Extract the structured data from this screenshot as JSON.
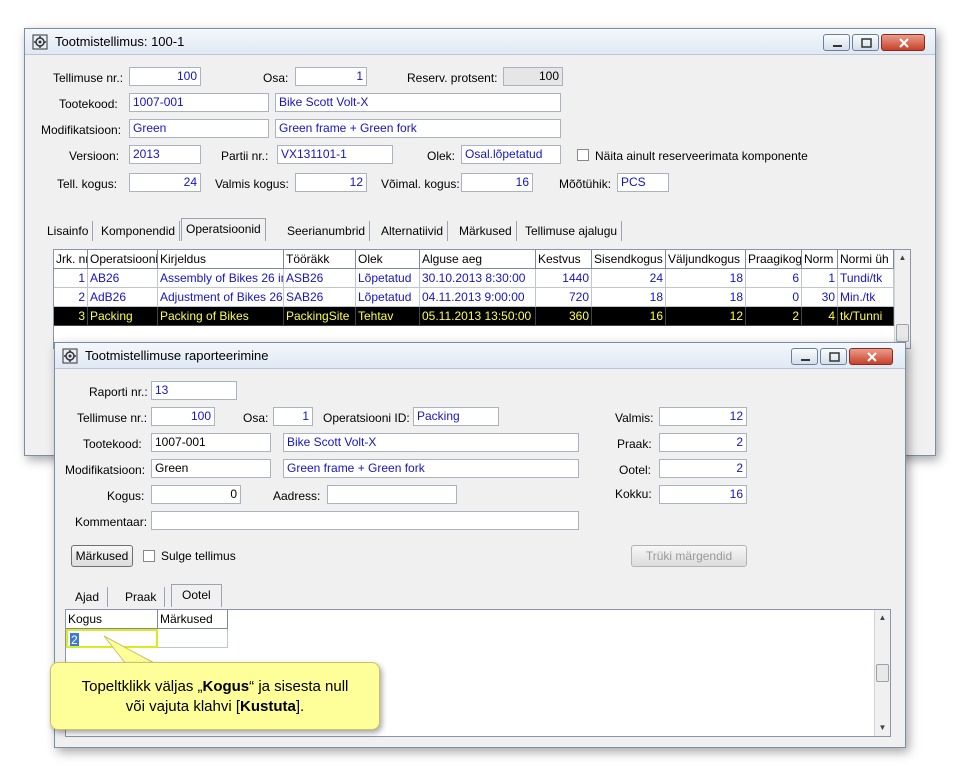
{
  "main_window": {
    "title": "Tootmistellimus: 100-1",
    "fields": {
      "tellimuse_nr": {
        "label": "Tellimuse nr.:",
        "value": "100"
      },
      "osa": {
        "label": "Osa:",
        "value": "1"
      },
      "reserv": {
        "label": "Reserv. protsent:",
        "value": "100"
      },
      "tootekood": {
        "label": "Tootekood:",
        "value": "1007-001",
        "desc": "Bike Scott Volt-X"
      },
      "modifikatsioon": {
        "label": "Modifikatsioon:",
        "value": "Green",
        "desc": "Green frame + Green fork"
      },
      "versioon": {
        "label": "Versioon:",
        "value": "2013"
      },
      "partii": {
        "label": "Partii nr.:",
        "value": "VX131101-1"
      },
      "olek": {
        "label": "Olek:",
        "value": "Osal.lõpetatud"
      },
      "naita_checkbox": "Näita ainult reserveerimata komponente",
      "tell_kogus": {
        "label": "Tell. kogus:",
        "value": "24"
      },
      "valmis_kogus": {
        "label": "Valmis kogus:",
        "value": "12"
      },
      "voimal_kogus": {
        "label": "Võimal. kogus:",
        "value": "16"
      },
      "mootuhik": {
        "label": "Mõõtühik:",
        "value": "PCS"
      }
    },
    "tabs": [
      "Lisainfo",
      "Komponendid",
      "Operatsioonid",
      "Seerianumbrid",
      "Alternatiivid",
      "Märkused",
      "Tellimuse ajalugu"
    ],
    "grid": {
      "headers": [
        "Jrk. nr",
        "Operatsiooni",
        "Kirjeldus",
        "Tööräkk",
        "Olek",
        "Alguse aeg",
        "Kestvus",
        "Sisendkogus",
        "Väljundkogus",
        "Praagikog",
        "Norm",
        "Normi üh"
      ],
      "rows": [
        [
          "1",
          "AB26",
          "Assembly of Bikes 26 in",
          "ASB26",
          "Lõpetatud",
          "30.10.2013 8:30:00",
          "1440",
          "24",
          "18",
          "6",
          "1",
          "Tundi/tk"
        ],
        [
          "2",
          "AdB26",
          "Adjustment of Bikes 26",
          "SAB26",
          "Lõpetatud",
          "04.11.2013 9:00:00",
          "720",
          "18",
          "18",
          "0",
          "30",
          "Min./tk"
        ],
        [
          "3",
          "Packing",
          "Packing of Bikes",
          "PackingSite",
          "Tehtav",
          "05.11.2013 13:50:00",
          "360",
          "16",
          "12",
          "2",
          "4",
          "tk/Tunni"
        ]
      ]
    }
  },
  "report_window": {
    "title": "Tootmistellimuse raporteerimine",
    "fields": {
      "raporti_nr": {
        "label": "Raporti nr.:",
        "value": "13"
      },
      "tellimuse_nr": {
        "label": "Tellimuse nr.:",
        "value": "100"
      },
      "osa": {
        "label": "Osa:",
        "value": "1"
      },
      "operatsiooni_id": {
        "label": "Operatsiooni ID:",
        "value": "Packing"
      },
      "tootekood": {
        "label": "Tootekood:",
        "value": "1007-001",
        "desc": "Bike Scott Volt-X"
      },
      "modifikatsioon": {
        "label": "Modifikatsioon:",
        "value": "Green",
        "desc": "Green frame + Green fork"
      },
      "kogus": {
        "label": "Kogus:",
        "value": "0"
      },
      "aadress": {
        "label": "Aadress:",
        "value": ""
      },
      "kommentaar": {
        "label": "Kommentaar:",
        "value": ""
      },
      "valmis": {
        "label": "Valmis:",
        "value": "12"
      },
      "praak": {
        "label": "Praak:",
        "value": "2"
      },
      "ootel": {
        "label": "Ootel:",
        "value": "2"
      },
      "kokku": {
        "label": "Kokku:",
        "value": "16"
      }
    },
    "markused_button": "Märkused",
    "sulge_checkbox": "Sulge tellimus",
    "print_button": "Trüki märgendid",
    "tabs": [
      "Ajad",
      "Praak",
      "Ootel"
    ],
    "grid": {
      "headers": [
        "Kogus",
        "Märkused"
      ],
      "rows": [
        [
          "2",
          ""
        ]
      ]
    }
  },
  "callout": {
    "line1_pre": "Topeltklikk väljas „",
    "line1_bold": "Kogus",
    "line1_post": "“ ja sisesta null",
    "line2_pre": "või vajuta klahvi [",
    "line2_bold": "Kustuta",
    "line2_post": "]."
  },
  "colors": {
    "field_text": "#1414c8",
    "selected_row_bg": "#000000",
    "selected_row_text": "#ffff40",
    "callout_bg": "#ffff99"
  }
}
